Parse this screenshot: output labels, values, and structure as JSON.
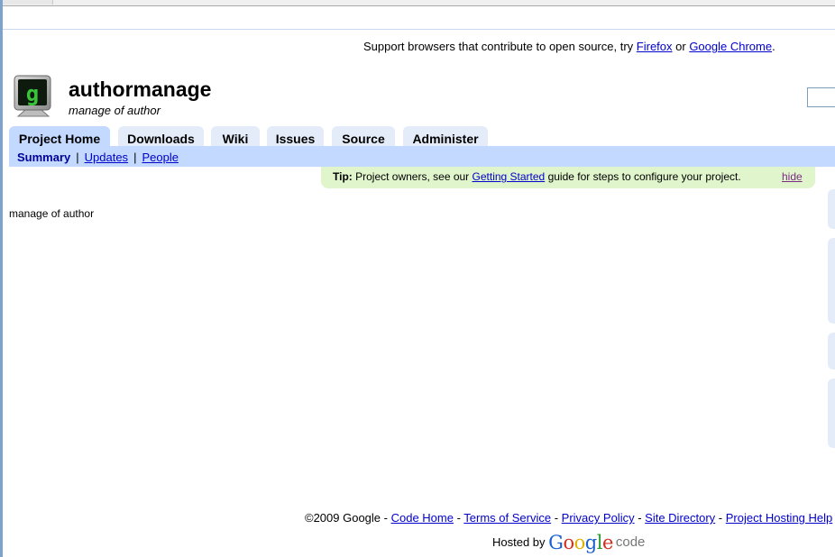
{
  "notice": {
    "prefix": "Support browsers that contribute to open source, try ",
    "link1": "Firefox",
    "mid": " or ",
    "link2": "Google Chrome",
    "suffix": "."
  },
  "project": {
    "name": "authormanage",
    "summary": "manage of author",
    "logo_icon": "monitor-logo-icon"
  },
  "tabs": [
    {
      "label": "Project Home",
      "active": true
    },
    {
      "label": "Downloads"
    },
    {
      "label": "Wiki"
    },
    {
      "label": "Issues"
    },
    {
      "label": "Source"
    },
    {
      "label": "Administer"
    }
  ],
  "subnav": {
    "summary": "Summary",
    "updates": "Updates",
    "people": "People",
    "separator": "|"
  },
  "tip": {
    "label": "Tip:",
    "text_before": " Project owners, see our ",
    "link": "Getting Started",
    "text_after": " guide for steps to configure your project.",
    "hide": "hide"
  },
  "description": "manage of author",
  "footer": {
    "copyright": "©2009 Google",
    "dash": " - ",
    "links": [
      "Code Home",
      "Terms of Service",
      "Privacy Policy",
      "Site Directory",
      "Project Hosting Help"
    ],
    "hosted_by": "Hosted by",
    "google_letters": [
      "G",
      "o",
      "o",
      "g",
      "l",
      "e"
    ],
    "code_word": "code"
  },
  "colors": {
    "tab": "#e5ecf9",
    "tab_active": "#c3d9ff",
    "link": "#0000cc",
    "tip_bg": "#e0f5cc",
    "google_letters": [
      "#1a5fd0",
      "#d03020",
      "#e0b000",
      "#1a5fd0",
      "#2a9a30",
      "#d03020"
    ]
  }
}
